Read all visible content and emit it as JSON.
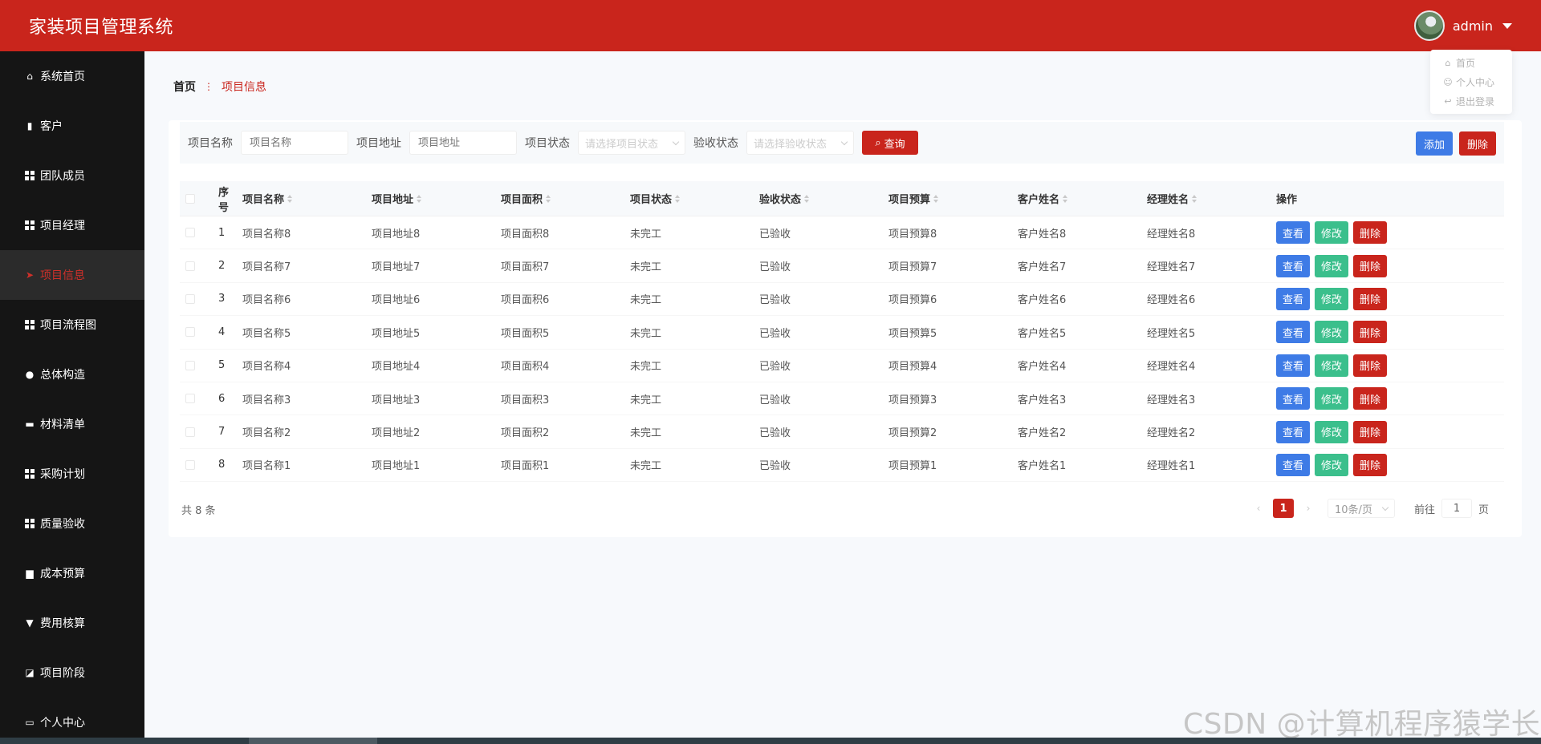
{
  "header": {
    "title": "家装项目管理系统",
    "username": "admin"
  },
  "user_menu": [
    {
      "icon": "home-icon",
      "label": "首页"
    },
    {
      "icon": "user-icon",
      "label": "个人中心"
    },
    {
      "icon": "logout-icon",
      "label": "退出登录"
    }
  ],
  "sidebar": {
    "items": [
      {
        "label": "系统首页",
        "icon": "home-icon"
      },
      {
        "label": "客户",
        "icon": "clipboard-icon"
      },
      {
        "label": "团队成员",
        "icon": "grid-icon"
      },
      {
        "label": "项目经理",
        "icon": "grid-icon"
      },
      {
        "label": "项目信息",
        "icon": "paper-plane-icon",
        "active": true
      },
      {
        "label": "项目流程图",
        "icon": "grid-icon"
      },
      {
        "label": "总体构造",
        "icon": "person-icon"
      },
      {
        "label": "材料清单",
        "icon": "ticket-icon"
      },
      {
        "label": "采购计划",
        "icon": "grid-icon"
      },
      {
        "label": "质量验收",
        "icon": "grid-icon"
      },
      {
        "label": "成本预算",
        "icon": "wallet-icon"
      },
      {
        "label": "费用核算",
        "icon": "cash-icon"
      },
      {
        "label": "项目阶段",
        "icon": "chart-icon"
      },
      {
        "label": "个人中心",
        "icon": "card-icon"
      }
    ]
  },
  "breadcrumb": {
    "home": "首页",
    "separator": "⋮",
    "current": "项目信息"
  },
  "search": {
    "name_label": "项目名称",
    "name_placeholder": "项目名称",
    "address_label": "项目地址",
    "address_placeholder": "项目地址",
    "status_label": "项目状态",
    "status_placeholder": "请选择项目状态",
    "acceptance_label": "验收状态",
    "acceptance_placeholder": "请选择验收状态",
    "query_label": "查询"
  },
  "toolbar": {
    "add_label": "添加",
    "delete_label": "删除"
  },
  "table": {
    "columns": [
      "序号",
      "项目名称",
      "项目地址",
      "项目面积",
      "项目状态",
      "验收状态",
      "项目预算",
      "客户姓名",
      "经理姓名",
      "操作"
    ],
    "actions": {
      "view": "查看",
      "edit": "修改",
      "delete": "删除"
    },
    "rows": [
      [
        "1",
        "项目名称8",
        "项目地址8",
        "项目面积8",
        "未完工",
        "已验收",
        "项目预算8",
        "客户姓名8",
        "经理姓名8"
      ],
      [
        "2",
        "项目名称7",
        "项目地址7",
        "项目面积7",
        "未完工",
        "已验收",
        "项目预算7",
        "客户姓名7",
        "经理姓名7"
      ],
      [
        "3",
        "项目名称6",
        "项目地址6",
        "项目面积6",
        "未完工",
        "已验收",
        "项目预算6",
        "客户姓名6",
        "经理姓名6"
      ],
      [
        "4",
        "项目名称5",
        "项目地址5",
        "项目面积5",
        "未完工",
        "已验收",
        "项目预算5",
        "客户姓名5",
        "经理姓名5"
      ],
      [
        "5",
        "项目名称4",
        "项目地址4",
        "项目面积4",
        "未完工",
        "已验收",
        "项目预算4",
        "客户姓名4",
        "经理姓名4"
      ],
      [
        "6",
        "项目名称3",
        "项目地址3",
        "项目面积3",
        "未完工",
        "已验收",
        "项目预算3",
        "客户姓名3",
        "经理姓名3"
      ],
      [
        "7",
        "项目名称2",
        "项目地址2",
        "项目面积2",
        "未完工",
        "已验收",
        "项目预算2",
        "客户姓名2",
        "经理姓名2"
      ],
      [
        "8",
        "项目名称1",
        "项目地址1",
        "项目面积1",
        "未完工",
        "已验收",
        "项目预算1",
        "客户姓名1",
        "经理姓名1"
      ]
    ]
  },
  "pagination": {
    "total": "共 8 条",
    "current_page": "1",
    "page_size": "10条/页",
    "goto_label": "前往",
    "goto_value": "1",
    "page_unit": "页"
  },
  "watermark": "CSDN @计算机程序猿学长",
  "colors": {
    "primary": "#c9251c",
    "sidebar": "#151515",
    "view": "#3e7be6",
    "edit": "#3bbf8c",
    "delete": "#c9251c"
  }
}
